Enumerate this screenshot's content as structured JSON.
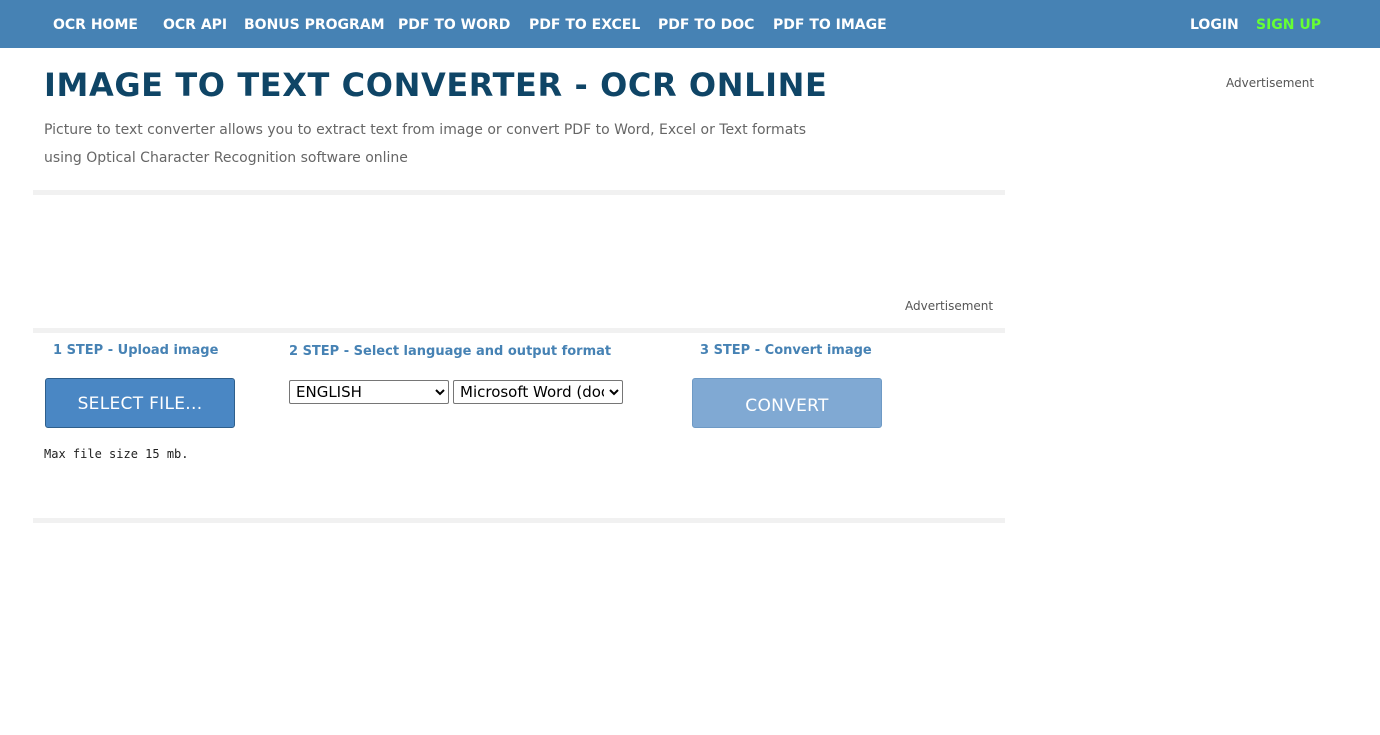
{
  "nav": {
    "items": [
      {
        "label": "OCR HOME"
      },
      {
        "label": "OCR API"
      },
      {
        "label": "BONUS PROGRAM"
      },
      {
        "label": "PDF TO WORD"
      },
      {
        "label": "PDF TO EXCEL"
      },
      {
        "label": "PDF TO DOC"
      },
      {
        "label": "PDF TO IMAGE"
      }
    ],
    "login": "LOGIN",
    "signup": "SIGN UP"
  },
  "colors": {
    "nav_background": "#4682b4",
    "signup_accent": "#66ff33",
    "title": "#0f4566",
    "step_heading": "#4682b4",
    "select_button": "#4a87c4",
    "convert_button": "#80a9d3"
  },
  "header": {
    "title": "IMAGE TO TEXT CONVERTER - OCR ONLINE",
    "description": "Picture to text converter allows you to extract text from image or convert PDF to Word, Excel or Text formats using Optical Character Recognition software online"
  },
  "ads": {
    "sidebar_label": "Advertisement",
    "banner_label": "Advertisement"
  },
  "steps": {
    "step1": {
      "heading": "1 STEP - Upload image",
      "button_label": "SELECT FILE...",
      "max_size_note": "Max file size 15 mb."
    },
    "step2": {
      "heading": "2 STEP - Select language and output format",
      "language_selected": "ENGLISH",
      "format_selected": "Microsoft Word (docx)"
    },
    "step3": {
      "heading": "3 STEP - Convert image",
      "button_label": "CONVERT"
    }
  }
}
